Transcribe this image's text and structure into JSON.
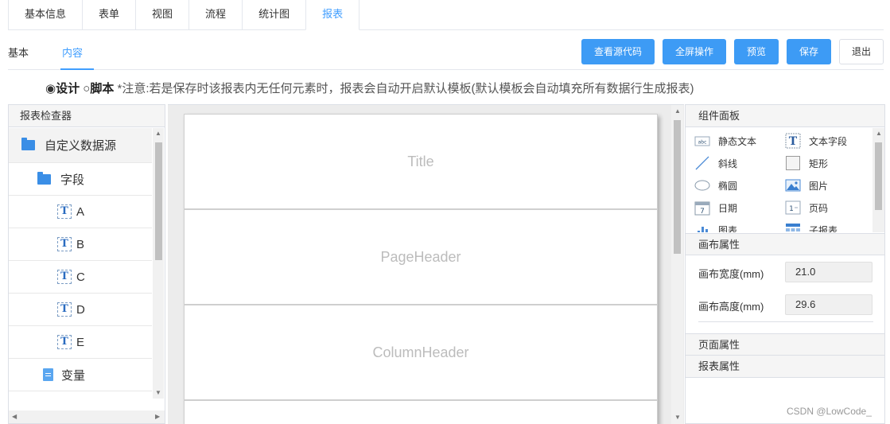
{
  "top_tabs": [
    "基本信息",
    "表单",
    "视图",
    "流程",
    "统计图",
    "报表"
  ],
  "sub_tabs": [
    "基本",
    "内容"
  ],
  "toolbar": {
    "view_source": "查看源代码",
    "fullscreen": "全屏操作",
    "preview": "预览",
    "save": "保存",
    "exit": "退出"
  },
  "mode": {
    "design_radio": "◉",
    "design_label": "设计",
    "script_radio": "○",
    "script_label": "脚本",
    "note": "*注意:若是保存时该报表内无任何元素时，报表会自动开启默认模板(默认模板会自动填充所有数据行生成报表)"
  },
  "inspector": {
    "title": "报表检查器",
    "root": "自定义数据源",
    "fields_folder": "字段",
    "fields": [
      "A",
      "B",
      "C",
      "D",
      "E"
    ],
    "variables": "变量"
  },
  "canvas": {
    "bands": [
      "Title",
      "PageHeader",
      "ColumnHeader"
    ]
  },
  "components": {
    "title": "组件面板",
    "items": [
      "静态文本",
      "文本字段",
      "斜线",
      "矩形",
      "椭圆",
      "图片",
      "日期",
      "页码",
      "图表",
      "子报表"
    ]
  },
  "canvas_props": {
    "title": "画布属性",
    "width_label": "画布宽度(mm)",
    "width_value": "21.0",
    "height_label": "画布高度(mm)",
    "height_value": "29.6"
  },
  "page_props": {
    "title": "页面属性"
  },
  "report_props": {
    "title": "报表属性"
  },
  "watermark": "CSDN @LowCode_",
  "colors": {
    "accent": "#409eff",
    "button": "#3d9bf5"
  }
}
